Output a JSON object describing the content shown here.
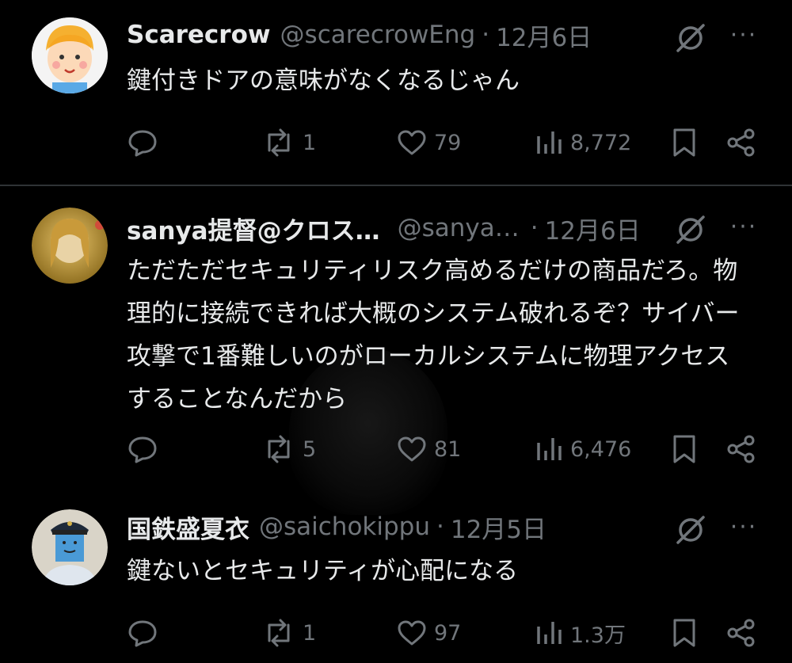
{
  "tweets": [
    {
      "name": "Scarecrow",
      "handle": "@scarecrowEng",
      "separator": "·",
      "date": "12月6日",
      "text": "鍵付きドアの意味がなくなるじゃん",
      "replies": "",
      "retweets": "1",
      "likes": "79",
      "views": "8,772",
      "avatar": "cartoon-boy"
    },
    {
      "name": "sanya提督@クロス…",
      "handle": "@sanya…",
      "separator": "·",
      "date": "12月6日",
      "text": "ただただセキュリティリスク高めるだけの商品だろ。物理的に接続できれば大概のシステム破れるぞ？サイバー攻撃で1番難しいのがローカルシステムに物理アクセスすることなんだから",
      "replies": "",
      "retweets": "5",
      "likes": "81",
      "views": "6,476",
      "avatar": "photo-blonde"
    },
    {
      "name": "国鉄盛夏衣",
      "handle": "@saichokippu",
      "separator": "·",
      "date": "12月5日",
      "text": "鍵ないとセキュリティが心配になる",
      "replies": "",
      "retweets": "1",
      "likes": "97",
      "views": "1.3万",
      "avatar": "uniform-person"
    }
  ],
  "more_label": "···",
  "colors": {
    "background": "#000000",
    "text": "#e7e9ea",
    "muted": "#71767b",
    "divider": "#2f3336"
  }
}
